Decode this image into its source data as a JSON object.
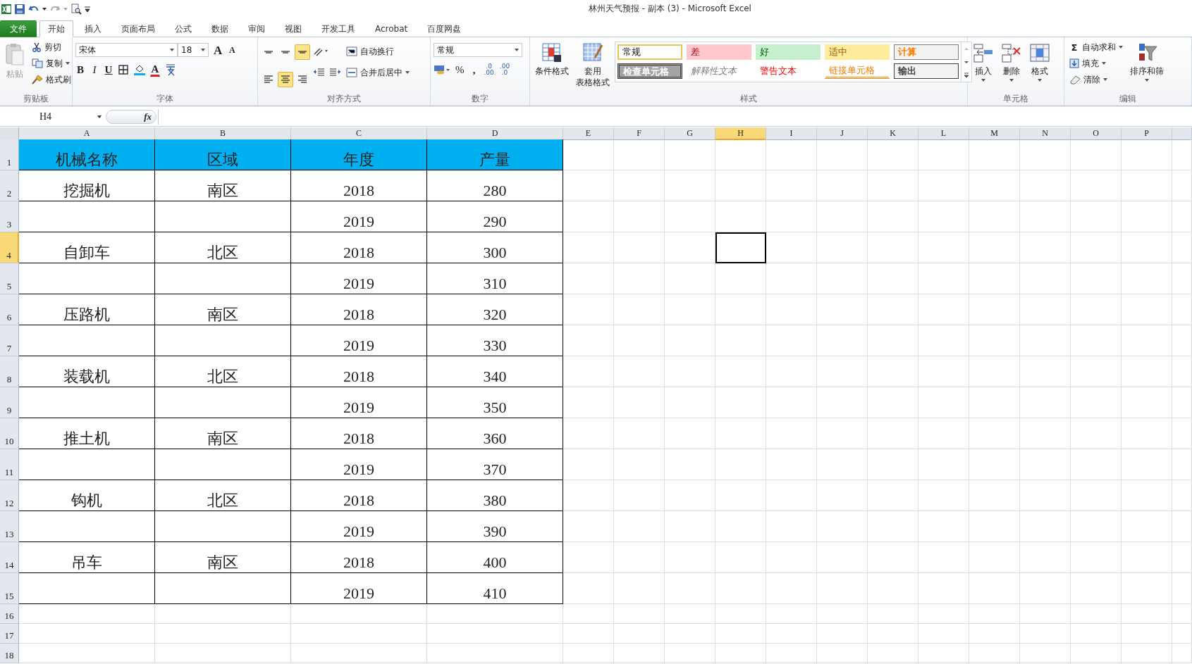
{
  "window": {
    "title": "林州天气预报 - 副本 (3)  -  Microsoft Excel"
  },
  "tabs": [
    {
      "label": "文件",
      "kind": "file",
      "selected": false
    },
    {
      "label": "开始",
      "kind": "tab",
      "selected": true
    },
    {
      "label": "插入",
      "kind": "tab",
      "selected": false
    },
    {
      "label": "页面布局",
      "kind": "tab",
      "selected": false
    },
    {
      "label": "公式",
      "kind": "tab",
      "selected": false
    },
    {
      "label": "数据",
      "kind": "tab",
      "selected": false
    },
    {
      "label": "审阅",
      "kind": "tab",
      "selected": false
    },
    {
      "label": "视图",
      "kind": "tab",
      "selected": false
    },
    {
      "label": "开发工具",
      "kind": "tab",
      "selected": false
    },
    {
      "label": "Acrobat",
      "kind": "tab",
      "selected": false
    },
    {
      "label": "百度网盘",
      "kind": "tab",
      "selected": false
    }
  ],
  "ribbon": {
    "clipboard": {
      "paste": "粘贴",
      "items": [
        {
          "label": "剪切",
          "kind": "cut"
        },
        {
          "label": "复制",
          "kind": "copy"
        },
        {
          "label": "格式刷",
          "kind": "brush"
        }
      ],
      "group": "剪贴板"
    },
    "font": {
      "name": "宋体",
      "size": "18",
      "grow": "A",
      "shrink": "A",
      "styles": [
        "B",
        "I",
        "U"
      ],
      "color_label": "A",
      "group": "字体"
    },
    "alignment": {
      "buttons": [
        {
          "kind": "top",
          "selected": false
        },
        {
          "kind": "middle",
          "selected": false
        },
        {
          "kind": "bottom",
          "selected": true
        },
        {
          "kind": "left",
          "selected": false
        },
        {
          "kind": "center",
          "selected": true
        },
        {
          "kind": "right",
          "selected": false
        }
      ],
      "wrap": "自动换行",
      "merge": "合并后居中",
      "group": "对齐方式"
    },
    "number": {
      "format": "常规",
      "percent": "%",
      "comma": ",",
      "decimals": [
        {
          "top": ".0",
          "bottom": ".00"
        },
        {
          "top": ".00",
          "bottom": ".0"
        }
      ],
      "group": "数字"
    },
    "styles": {
      "conditional": "条件格式",
      "table_format": [
        "套用",
        "表格格式"
      ],
      "items": [
        {
          "label": "常规",
          "kind": "normal"
        },
        {
          "label": "差",
          "kind": "bad"
        },
        {
          "label": "好",
          "kind": "good"
        },
        {
          "label": "适中",
          "kind": "neutral"
        },
        {
          "label": "计算",
          "kind": "calc"
        },
        {
          "label": "检查单元格",
          "kind": "check"
        },
        {
          "label": "解释性文本",
          "kind": "explanatory"
        },
        {
          "label": "警告文本",
          "kind": "warning"
        },
        {
          "label": "链接单元格",
          "kind": "linked"
        },
        {
          "label": "输出",
          "kind": "output"
        }
      ],
      "group": "样式"
    },
    "cells": {
      "buttons": [
        {
          "label": "插入",
          "kind": "insert"
        },
        {
          "label": "删除",
          "kind": "delete"
        },
        {
          "label": "格式",
          "kind": "format"
        }
      ],
      "group": "单元格"
    },
    "editing": {
      "sum_symbol": "Σ",
      "items": [
        {
          "label": "自动求和",
          "kind": "sum"
        },
        {
          "label": "填充",
          "kind": "fill"
        },
        {
          "label": "清除",
          "kind": "clear"
        }
      ],
      "sort": "排序和筛",
      "group": "编辑"
    }
  },
  "formula_bar": {
    "name_box": "H4",
    "fx": "fx"
  },
  "sheet": {
    "columns": [
      {
        "label": "A",
        "selected": false
      },
      {
        "label": "B",
        "selected": false
      },
      {
        "label": "C",
        "selected": false
      },
      {
        "label": "D",
        "selected": false
      },
      {
        "label": "E",
        "selected": false
      },
      {
        "label": "F",
        "selected": false
      },
      {
        "label": "G",
        "selected": false
      },
      {
        "label": "H",
        "selected": true
      },
      {
        "label": "I",
        "selected": false
      },
      {
        "label": "J",
        "selected": false
      },
      {
        "label": "K",
        "selected": false
      },
      {
        "label": "L",
        "selected": false
      },
      {
        "label": "M",
        "selected": false
      },
      {
        "label": "N",
        "selected": false
      },
      {
        "label": "O",
        "selected": false
      },
      {
        "label": "P",
        "selected": false
      }
    ],
    "rows": [
      {
        "number": "1",
        "kind": "header",
        "selected": false,
        "name": "机械名称",
        "region": "区域",
        "year": "年度",
        "output": "产量"
      },
      {
        "number": "2",
        "kind": "data",
        "selected": false,
        "name": "挖掘机",
        "region": "南区",
        "year": "2018",
        "output": "280"
      },
      {
        "number": "3",
        "kind": "data",
        "selected": false,
        "year": "2019",
        "output": "290"
      },
      {
        "number": "4",
        "kind": "data",
        "selected": true,
        "name": "自卸车",
        "region": "北区",
        "year": "2018",
        "output": "300"
      },
      {
        "number": "5",
        "kind": "data",
        "selected": false,
        "year": "2019",
        "output": "310"
      },
      {
        "number": "6",
        "kind": "data",
        "selected": false,
        "name": "压路机",
        "region": "南区",
        "year": "2018",
        "output": "320"
      },
      {
        "number": "7",
        "kind": "data",
        "selected": false,
        "year": "2019",
        "output": "330"
      },
      {
        "number": "8",
        "kind": "data",
        "selected": false,
        "name": "装载机",
        "region": "北区",
        "year": "2018",
        "output": "340"
      },
      {
        "number": "9",
        "kind": "data",
        "selected": false,
        "year": "2019",
        "output": "350"
      },
      {
        "number": "10",
        "kind": "data",
        "selected": false,
        "name": "推土机",
        "region": "南区",
        "year": "2018",
        "output": "360"
      },
      {
        "number": "11",
        "kind": "data",
        "selected": false,
        "year": "2019",
        "output": "370"
      },
      {
        "number": "12",
        "kind": "data",
        "selected": false,
        "name": "钩机",
        "region": "北区",
        "year": "2018",
        "output": "380"
      },
      {
        "number": "13",
        "kind": "data",
        "selected": false,
        "year": "2019",
        "output": "390"
      },
      {
        "number": "14",
        "kind": "data",
        "selected": false,
        "name": "吊车",
        "region": "南区",
        "year": "2018",
        "output": "400"
      },
      {
        "number": "15",
        "kind": "data",
        "selected": false,
        "year": "2019",
        "output": "410"
      },
      {
        "number": "16",
        "kind": "empty",
        "selected": false
      },
      {
        "number": "17",
        "kind": "empty",
        "selected": false
      },
      {
        "number": "18",
        "kind": "empty",
        "selected": false
      }
    ]
  }
}
